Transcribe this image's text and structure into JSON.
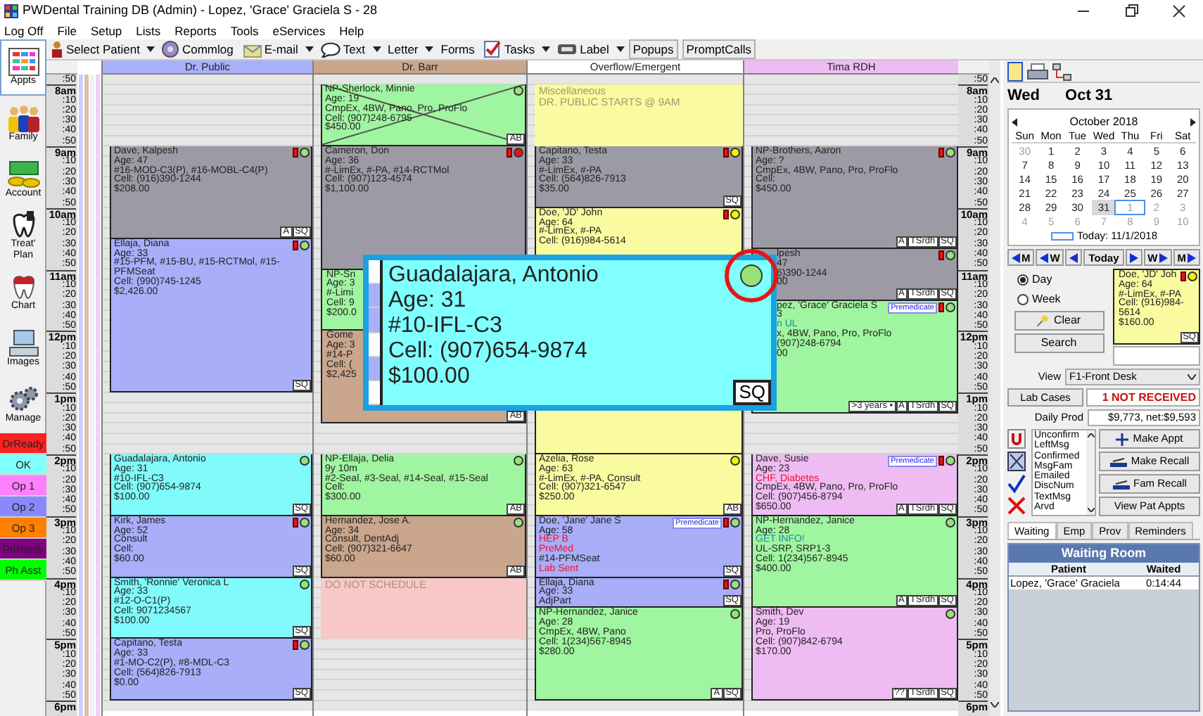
{
  "window": {
    "title": "PWDental Training DB (Admin) - Lopez, 'Grace' Graciela S - 28"
  },
  "menu": [
    "Log Off",
    "File",
    "Setup",
    "Lists",
    "Reports",
    "Tools",
    "eServices",
    "Help"
  ],
  "toolbar": [
    {
      "label": "Select Patient",
      "dropdown": true
    },
    {
      "label": "Commlog",
      "dropdown": false
    },
    {
      "label": "E-mail",
      "dropdown": true
    },
    {
      "label": "Text",
      "dropdown": true
    },
    {
      "label": "Letter",
      "dropdown": true
    },
    {
      "label": "Forms",
      "dropdown": false
    },
    {
      "label": "Tasks",
      "dropdown": true
    },
    {
      "label": "Label",
      "dropdown": true
    },
    {
      "label": "Popups",
      "dropdown": false
    },
    {
      "label": "PromptCalls",
      "dropdown": false
    }
  ],
  "modules": [
    {
      "label": "Appts",
      "selected": true
    },
    {
      "label": "Family",
      "selected": false
    },
    {
      "label": "Account",
      "selected": false
    },
    {
      "label": "Treat' Plan",
      "selected": false
    },
    {
      "label": "Chart",
      "selected": false
    },
    {
      "label": "Images",
      "selected": false
    },
    {
      "label": "Manage",
      "selected": false
    }
  ],
  "status_buttons": [
    {
      "label": "DrReady",
      "color": "#ff2020"
    },
    {
      "label": "OK",
      "color": "#80ffff"
    },
    {
      "label": "Op 1",
      "color": "#ff80ff"
    },
    {
      "label": "Op 2",
      "color": "#8888ff"
    },
    {
      "label": "Op 3",
      "color": "#ff8000"
    },
    {
      "label": "PtReady",
      "color": "#800080"
    },
    {
      "label": "Ph Asst",
      "color": "#00ff00"
    }
  ],
  "time_labels_left": [
    ":50",
    "8am",
    ":10",
    ":20",
    ":30",
    ":40",
    ":50",
    "9am",
    ":10",
    ":20",
    ":30",
    ":40",
    ":50",
    "10am",
    ":10",
    ":20",
    ":30",
    ":40",
    ":50",
    "11am",
    ":10",
    ":20",
    ":30",
    ":40",
    ":50",
    "12pm",
    ":10",
    ":20",
    ":30",
    ":40",
    ":50",
    "1pm",
    ":10",
    ":20",
    ":30",
    ":40",
    ":50",
    "2pm",
    ":10",
    ":20",
    ":30",
    ":40",
    ":50",
    "3pm",
    ":10",
    ":20",
    ":30",
    ":40",
    ":50",
    "4pm",
    ":10",
    ":20",
    ":30",
    ":40",
    ":50",
    "5pm",
    ":10",
    ":20",
    ":30",
    ":40",
    ":50",
    "6pm"
  ],
  "columns": [
    {
      "header": "Dr. Public",
      "color": "#a8b0f8",
      "appointments": [
        {
          "kind": "appointment",
          "color": "#9c9aa4",
          "lines": [
            "Dave, Kalpesh",
            "Age: 47",
            "#16-MOD-C3(P), #16-MOBL-C4(P)",
            "Cell: (916)390-1244",
            "$208.00"
          ],
          "flag": true,
          "dot": {
            "color": "#99e27a"
          },
          "broken": false,
          "tags": [
            "A",
            "SQ"
          ]
        },
        {
          "kind": "appointment",
          "color": "#a8aef8",
          "lines": [
            "Ellaja, Diana",
            "Age: 33",
            "#15-PFM, #15-BU, #15-RCTMol, #15-PFMSeat",
            "Cell: (990)745-1245",
            "$2,426.00"
          ],
          "flag": true,
          "dot": {
            "color": "#99e27a"
          },
          "broken": false,
          "tags": [
            "SQ"
          ]
        },
        {
          "kind": "appointment",
          "color": "#80fafa",
          "lines": [
            "Guadalajara, Antonio",
            "Age: 31",
            "#10-IFL-C3",
            "Cell: (907)654-9874",
            "$100.00"
          ],
          "flag": false,
          "dot": {
            "color": "#99e27a"
          },
          "broken": false,
          "tags": [
            "SQ"
          ]
        },
        {
          "kind": "appointment",
          "color": "#a8aef8",
          "lines": [
            "Kirk, James",
            "Age: 52",
            "Consult",
            "Cell:",
            "$60.00"
          ],
          "flag": true,
          "dot": {
            "color": "#99e27a"
          },
          "broken": false,
          "tags": [
            "SQ"
          ]
        },
        {
          "kind": "appointment",
          "color": "#80fafa",
          "lines": [
            "Smith, 'Ronnie' Veronica L",
            "Age: 33",
            "#12-O-C1(P)",
            "Cell: 9071234567",
            "$100.00"
          ],
          "flag": false,
          "dot": {
            "color": "#99e27a"
          },
          "broken": false,
          "tags": [
            "SQ"
          ]
        },
        {
          "kind": "appointment",
          "color": "#a8aef8",
          "lines": [
            "Capitano, Testa",
            "Age: 33",
            "#1-MO-C2(P), #8-MDL-C3",
            "Cell: (564)826-7913",
            "$0.00"
          ],
          "flag": true,
          "dot": {
            "color": "#99e27a"
          },
          "broken": false,
          "tags": [
            "SQ"
          ]
        }
      ]
    },
    {
      "header": "Dr. Barr",
      "color": "#c9a68c",
      "appointments": [
        {
          "kind": "appointment",
          "color": "#a0f5a0",
          "lines": [
            "NP-Sherlock, Minnie",
            "Age: 19",
            "CmpEx, 4BW, Pano, Pro, ProFlo",
            "Cell: (907)248-6795",
            "$450.00"
          ],
          "flag": false,
          "dot": {
            "color": "#99e27a"
          },
          "broken": true,
          "tags": [
            "AB"
          ]
        },
        {
          "kind": "appointment",
          "color": "#9c9aa4",
          "lines": [
            "Cameron, Don",
            "Age: 36",
            "#-LimEx, #-PA, #14-RCTMol",
            "Cell: (907)123-4574",
            "$1,100.00"
          ],
          "flag": true,
          "dot": {
            "color": "#ee1111"
          },
          "broken": false
        },
        {
          "kind": "appointment",
          "color": "#a0f5a0",
          "lines": [
            "NP-Sn",
            "Age: 3",
            "#-Limi",
            "Cell: 9",
            "$200.0"
          ]
        },
        {
          "kind": "appointment",
          "color": "#c9a68c",
          "lines": [
            "Gome",
            "Age: 3",
            "#14-P",
            "Cell: (",
            "$2,425"
          ],
          "tags": [
            "AB"
          ]
        },
        {
          "kind": "appointment",
          "color": "#a0f5a0",
          "lines": [
            "NP-Ellaja, Delia",
            "9y 10m",
            "#2-Seal, #3-Seal, #14-Seal, #15-Seal",
            "Cell:",
            "$300.00"
          ],
          "flag": false,
          "dot": {
            "color": "#99e27a"
          },
          "broken": false,
          "tags": [
            "AB"
          ]
        },
        {
          "kind": "appointment",
          "color": "#c9a68c",
          "lines": [
            "Hernandez, Jose A.",
            "Age: 34",
            "Consult, DentAdj",
            "Cell: (907)321-6647",
            "$60.00"
          ],
          "flag": false,
          "dot": {
            "color": "#99e27a"
          },
          "broken": false,
          "tags": [
            "AB"
          ]
        },
        {
          "kind": "blockout",
          "color": "#f8c8c8",
          "lines": [
            "DO NOT SCHEDULE"
          ]
        }
      ]
    },
    {
      "header": "Overflow/Emergent",
      "color": "#ffffff",
      "appointments": [
        {
          "kind": "blockout",
          "color": "#fafaa0",
          "lines": [
            "Miscellaneous",
            "DR. PUBLIC STARTS @ 9AM"
          ]
        },
        {
          "kind": "appointment",
          "color": "#9c9aa4",
          "lines": [
            "Capitano, Testa",
            "Age: 33",
            "#-LimEx, #-PA",
            "Cell: (564)826-7913",
            "$35.00"
          ],
          "flag": true,
          "dot": {
            "color": "#f4f400"
          },
          "broken": false,
          "tags": [
            "SQ"
          ]
        },
        {
          "kind": "appointment",
          "color": "#fafaa0",
          "lines": [
            "Doe, 'JD' John",
            "Age: 64",
            "#-LimEx, #-PA",
            "Cell: (916)984-5614"
          ],
          "flag": true,
          "dot": {
            "color": "#f4f400"
          },
          "broken": false
        },
        {
          "kind": "appointment",
          "color": "#fafaa0",
          "lines": [
            "Azelia, Rose",
            "Age: 63",
            "#-LimEx, #-PA, Consult",
            "Cell: (907)321-6547",
            "$250.00"
          ],
          "flag": false,
          "dot": {
            "color": "#f4f400"
          },
          "broken": false,
          "tags": [
            "AB"
          ]
        },
        {
          "kind": "appointment",
          "color": "#a8aef8",
          "lines": [
            "Doe, 'Jane' Jane S",
            "Age: 58",
            {
              "text": "HEP B",
              "kind": "alert"
            },
            {
              "text": "PreMed",
              "kind": "alert"
            },
            "#14-PFMSeat",
            {
              "text": "Lab Sent",
              "kind": "alert"
            }
          ],
          "badge": "Premedicate",
          "flag": true,
          "dot": {
            "color": "#99e27a"
          },
          "broken": false,
          "tags": [
            "SQ"
          ]
        },
        {
          "kind": "appointment",
          "color": "#a8aef8",
          "lines": [
            "Ellaja, Diana",
            "Age: 33",
            "AdjPart"
          ],
          "flag": true,
          "dot": {
            "color": "#99e27a"
          },
          "broken": false,
          "tags": [
            "SQ"
          ]
        },
        {
          "kind": "appointment",
          "color": "#a0f5a0",
          "lines": [
            "NP-Hernandez, Janice",
            "Age: 28",
            "CmpEx, 4BW, Pano",
            "Cell: 1(234)567-8945",
            "$280.00"
          ],
          "flag": false,
          "dot": {
            "color": "#99e27a"
          },
          "broken": false,
          "tags": [
            "A",
            "SQ"
          ]
        }
      ]
    },
    {
      "header": "Tima RDH",
      "color": "#eebcf2",
      "appointments": [
        {
          "kind": "appointment",
          "color": "#9c9aa4",
          "lines": [
            "NP-Brothers, Aaron",
            "Age: ?",
            "CmpEx, 4BW, Pano, Pro, ProFlo",
            "Cell:",
            "$450.00"
          ],
          "flag": true,
          "dot": {
            "color": "#99e27a"
          },
          "broken": false,
          "tags": [
            "A",
            "TSrdh",
            "SQ"
          ]
        },
        {
          "kind": "appointment",
          "color": "#9c9aa4",
          "lines": [
            "lpesh",
            "47",
            "6)390-1244",
            "00"
          ],
          "flag": true,
          "dot": {
            "color": "#99e27a"
          },
          "broken": false,
          "tags": [
            "A",
            "TSrdh",
            "SQ"
          ]
        },
        {
          "kind": "appointment",
          "color": "#a0f5a0",
          "lines": [
            "pez, 'Grace' Graciela S",
            "3",
            {
              "text": "n UL",
              "kind": "note"
            },
            "x, 4BW, Pano, Pro, ProFlo",
            "(907)248-6794",
            "00"
          ],
          "badge": "Premedicate",
          "flag": true,
          "dot": {
            "color": "#99e27a"
          },
          "broken": false,
          "tags": [
            ">3 years •",
            "A",
            "TSrdh",
            "SQ"
          ]
        },
        {
          "kind": "appointment",
          "color": "#eebcf2",
          "lines": [
            "Dave, Susie",
            "Age: 23",
            {
              "text": "CHF, Diabetes",
              "kind": "alert"
            },
            "CmpEx, 4BW, Pano, Pro, ProFlo",
            "Cell: (907)456-8794",
            "$650.00"
          ],
          "badge": "Premedicate",
          "flag": true,
          "dot": {
            "color": "#99e27a"
          },
          "broken": false,
          "tags": [
            "A",
            "TSrdh",
            "SQ"
          ]
        },
        {
          "kind": "appointment",
          "color": "#a0f5a0",
          "lines": [
            "NP-Hernandez, Janice",
            "Age: 28",
            {
              "text": "GET INFO!",
              "kind": "note"
            },
            "UL-SRP, SRP1-3",
            "Cell: 1(234)567-8945",
            "$400.00"
          ],
          "flag": false,
          "dot": {
            "color": "#99e27a"
          },
          "broken": false,
          "tags": [
            "A",
            "TSrdh",
            "SQ"
          ]
        },
        {
          "kind": "appointment",
          "color": "#eebcf2",
          "lines": [
            "Smith, Dev",
            "Age: 19",
            "Pro, ProFlo",
            "Cell: (907)842-6794",
            "$170.00"
          ],
          "flag": false,
          "dot": {
            "color": "#99e27a"
          },
          "broken": false,
          "tags": [
            "??",
            "TSrdh",
            "SQ"
          ]
        }
      ]
    }
  ],
  "time_labels_right": [
    ":50",
    "8am",
    ":10",
    ":20",
    ":30",
    ":40",
    ":50",
    "9am",
    ":10",
    ":20",
    ":30",
    ":40",
    ":50",
    "10am",
    ":10",
    ":20",
    ":30",
    ":40",
    ":50",
    "11am",
    ":10",
    ":20",
    ":30",
    ":40",
    ":50",
    "12pm",
    ":10",
    ":20",
    ":30",
    ":40",
    ":50",
    "1pm",
    ":10",
    ":20",
    ":30",
    ":40",
    ":50",
    "2pm",
    ":10",
    ":20",
    ":30",
    ":40",
    ":50",
    "3pm",
    ":10",
    ":20",
    ":30",
    ":40",
    ":50",
    "4pm",
    ":10",
    ":20",
    ":30",
    ":40",
    ":50",
    "5pm",
    ":10",
    ":20",
    ":30",
    ":40",
    ":50",
    "6pm"
  ],
  "popup": {
    "color": "#80ffff",
    "lines": [
      "Guadalajara, Antonio",
      "Age: 31",
      "#10-IFL-C3",
      "Cell: (907)654-9874",
      "$100.00"
    ],
    "dot": {
      "color": "#99e27a"
    },
    "tags": [
      "SQ"
    ]
  },
  "date_header": {
    "weekday": "Wed",
    "date": "Oct 31"
  },
  "calendar": {
    "month": "October 2018",
    "weekdays": [
      "Sun",
      "Mon",
      "Tue",
      "Wed",
      "Thu",
      "Fri",
      "Sat"
    ],
    "weeks": [
      [
        {
          "d": "30",
          "muted": true,
          "selected": false,
          "today": false
        },
        {
          "d": "1",
          "muted": false,
          "selected": false,
          "today": false
        },
        {
          "d": "2",
          "muted": false,
          "selected": false,
          "today": false
        },
        {
          "d": "3",
          "muted": false,
          "selected": false,
          "today": false
        },
        {
          "d": "4",
          "muted": false,
          "selected": false,
          "today": false
        },
        {
          "d": "5",
          "muted": false,
          "selected": false,
          "today": false
        },
        {
          "d": "6",
          "muted": false,
          "selected": false,
          "today": false
        }
      ],
      [
        {
          "d": "7",
          "muted": false,
          "selected": false,
          "today": false
        },
        {
          "d": "8",
          "muted": false,
          "selected": false,
          "today": false
        },
        {
          "d": "9",
          "muted": false,
          "selected": false,
          "today": false
        },
        {
          "d": "10",
          "muted": false,
          "selected": false,
          "today": false
        },
        {
          "d": "11",
          "muted": false,
          "selected": false,
          "today": false
        },
        {
          "d": "12",
          "muted": false,
          "selected": false,
          "today": false
        },
        {
          "d": "13",
          "muted": false,
          "selected": false,
          "today": false
        }
      ],
      [
        {
          "d": "14",
          "muted": false,
          "selected": false,
          "today": false
        },
        {
          "d": "15",
          "muted": false,
          "selected": false,
          "today": false
        },
        {
          "d": "16",
          "muted": false,
          "selected": false,
          "today": false
        },
        {
          "d": "17",
          "muted": false,
          "selected": false,
          "today": false
        },
        {
          "d": "18",
          "muted": false,
          "selected": false,
          "today": false
        },
        {
          "d": "19",
          "muted": false,
          "selected": false,
          "today": false
        },
        {
          "d": "20",
          "muted": false,
          "selected": false,
          "today": false
        }
      ],
      [
        {
          "d": "21",
          "muted": false,
          "selected": false,
          "today": false
        },
        {
          "d": "22",
          "muted": false,
          "selected": false,
          "today": false
        },
        {
          "d": "23",
          "muted": false,
          "selected": false,
          "today": false
        },
        {
          "d": "24",
          "muted": false,
          "selected": false,
          "today": false
        },
        {
          "d": "25",
          "muted": false,
          "selected": false,
          "today": false
        },
        {
          "d": "26",
          "muted": false,
          "selected": false,
          "today": false
        },
        {
          "d": "27",
          "muted": false,
          "selected": false,
          "today": false
        }
      ],
      [
        {
          "d": "28",
          "muted": false,
          "selected": false,
          "today": false
        },
        {
          "d": "29",
          "muted": false,
          "selected": false,
          "today": false
        },
        {
          "d": "30",
          "muted": false,
          "selected": false,
          "today": false
        },
        {
          "d": "31",
          "muted": false,
          "selected": true,
          "today": false
        },
        {
          "d": "1",
          "muted": true,
          "selected": false,
          "today": true
        },
        {
          "d": "2",
          "muted": true,
          "selected": false,
          "today": false
        },
        {
          "d": "3",
          "muted": true,
          "selected": false,
          "today": false
        }
      ],
      [
        {
          "d": "4",
          "muted": true,
          "selected": false,
          "today": false
        },
        {
          "d": "5",
          "muted": true,
          "selected": false,
          "today": false
        },
        {
          "d": "6",
          "muted": true,
          "selected": false,
          "today": false
        },
        {
          "d": "7",
          "muted": true,
          "selected": false,
          "today": false
        },
        {
          "d": "8",
          "muted": true,
          "selected": false,
          "today": false
        },
        {
          "d": "9",
          "muted": true,
          "selected": false,
          "today": false
        },
        {
          "d": "10",
          "muted": true,
          "selected": false,
          "today": false
        }
      ]
    ],
    "today_label": "Today: 11/1/2018"
  },
  "nav_buttons": [
    {
      "label": "M",
      "kind": "back"
    },
    {
      "label": "W",
      "kind": "back"
    },
    {
      "kind": "back"
    },
    {
      "label": "Today",
      "kind": "plain"
    },
    {
      "kind": "forward"
    },
    {
      "label": "W",
      "kind": "forward"
    },
    {
      "label": "M",
      "kind": "forward"
    }
  ],
  "view_modes": [
    {
      "label": "Day",
      "selected": true
    },
    {
      "label": "Week",
      "selected": false
    }
  ],
  "clear_button": "Clear",
  "search_button": "Search",
  "mini_card": {
    "color": "#fafaa0",
    "lines": [
      "Doe, 'JD' Joh",
      "Age: 64",
      "#-LimEx, #-PA",
      "Cell: (916)984-5614",
      "$160.00"
    ],
    "flag": true,
    "dot": {
      "color": "#f4f400"
    },
    "tags": [
      "SQ"
    ]
  },
  "view": {
    "label": "View",
    "value": "F1-Front Desk"
  },
  "lab_cases": {
    "button": "Lab Cases",
    "value": "1 NOT RECEIVED"
  },
  "daily_prod": {
    "label": "Daily Prod",
    "value": "$9,773, net:$9,593"
  },
  "confirm_statuses": [
    "Unconfirm",
    "LeftMsg",
    "Confirmed",
    "MsgFam",
    "Emailed",
    "DiscNum",
    "TextMsg",
    "Arvd"
  ],
  "actions": [
    "Make Appt",
    "Make Recall",
    "Fam Recall",
    "View Pat Appts"
  ],
  "tabs": [
    {
      "label": "Waiting",
      "selected": true
    },
    {
      "label": "Emp",
      "selected": false
    },
    {
      "label": "Prov",
      "selected": false
    },
    {
      "label": "Reminders",
      "selected": false
    }
  ],
  "waiting_room": {
    "title": "Waiting Room",
    "columns": [
      "Patient",
      "Waited"
    ],
    "rows": [
      {
        "patient": "Lopez, 'Grace' Graciela",
        "waited": "0:14:44"
      }
    ]
  }
}
